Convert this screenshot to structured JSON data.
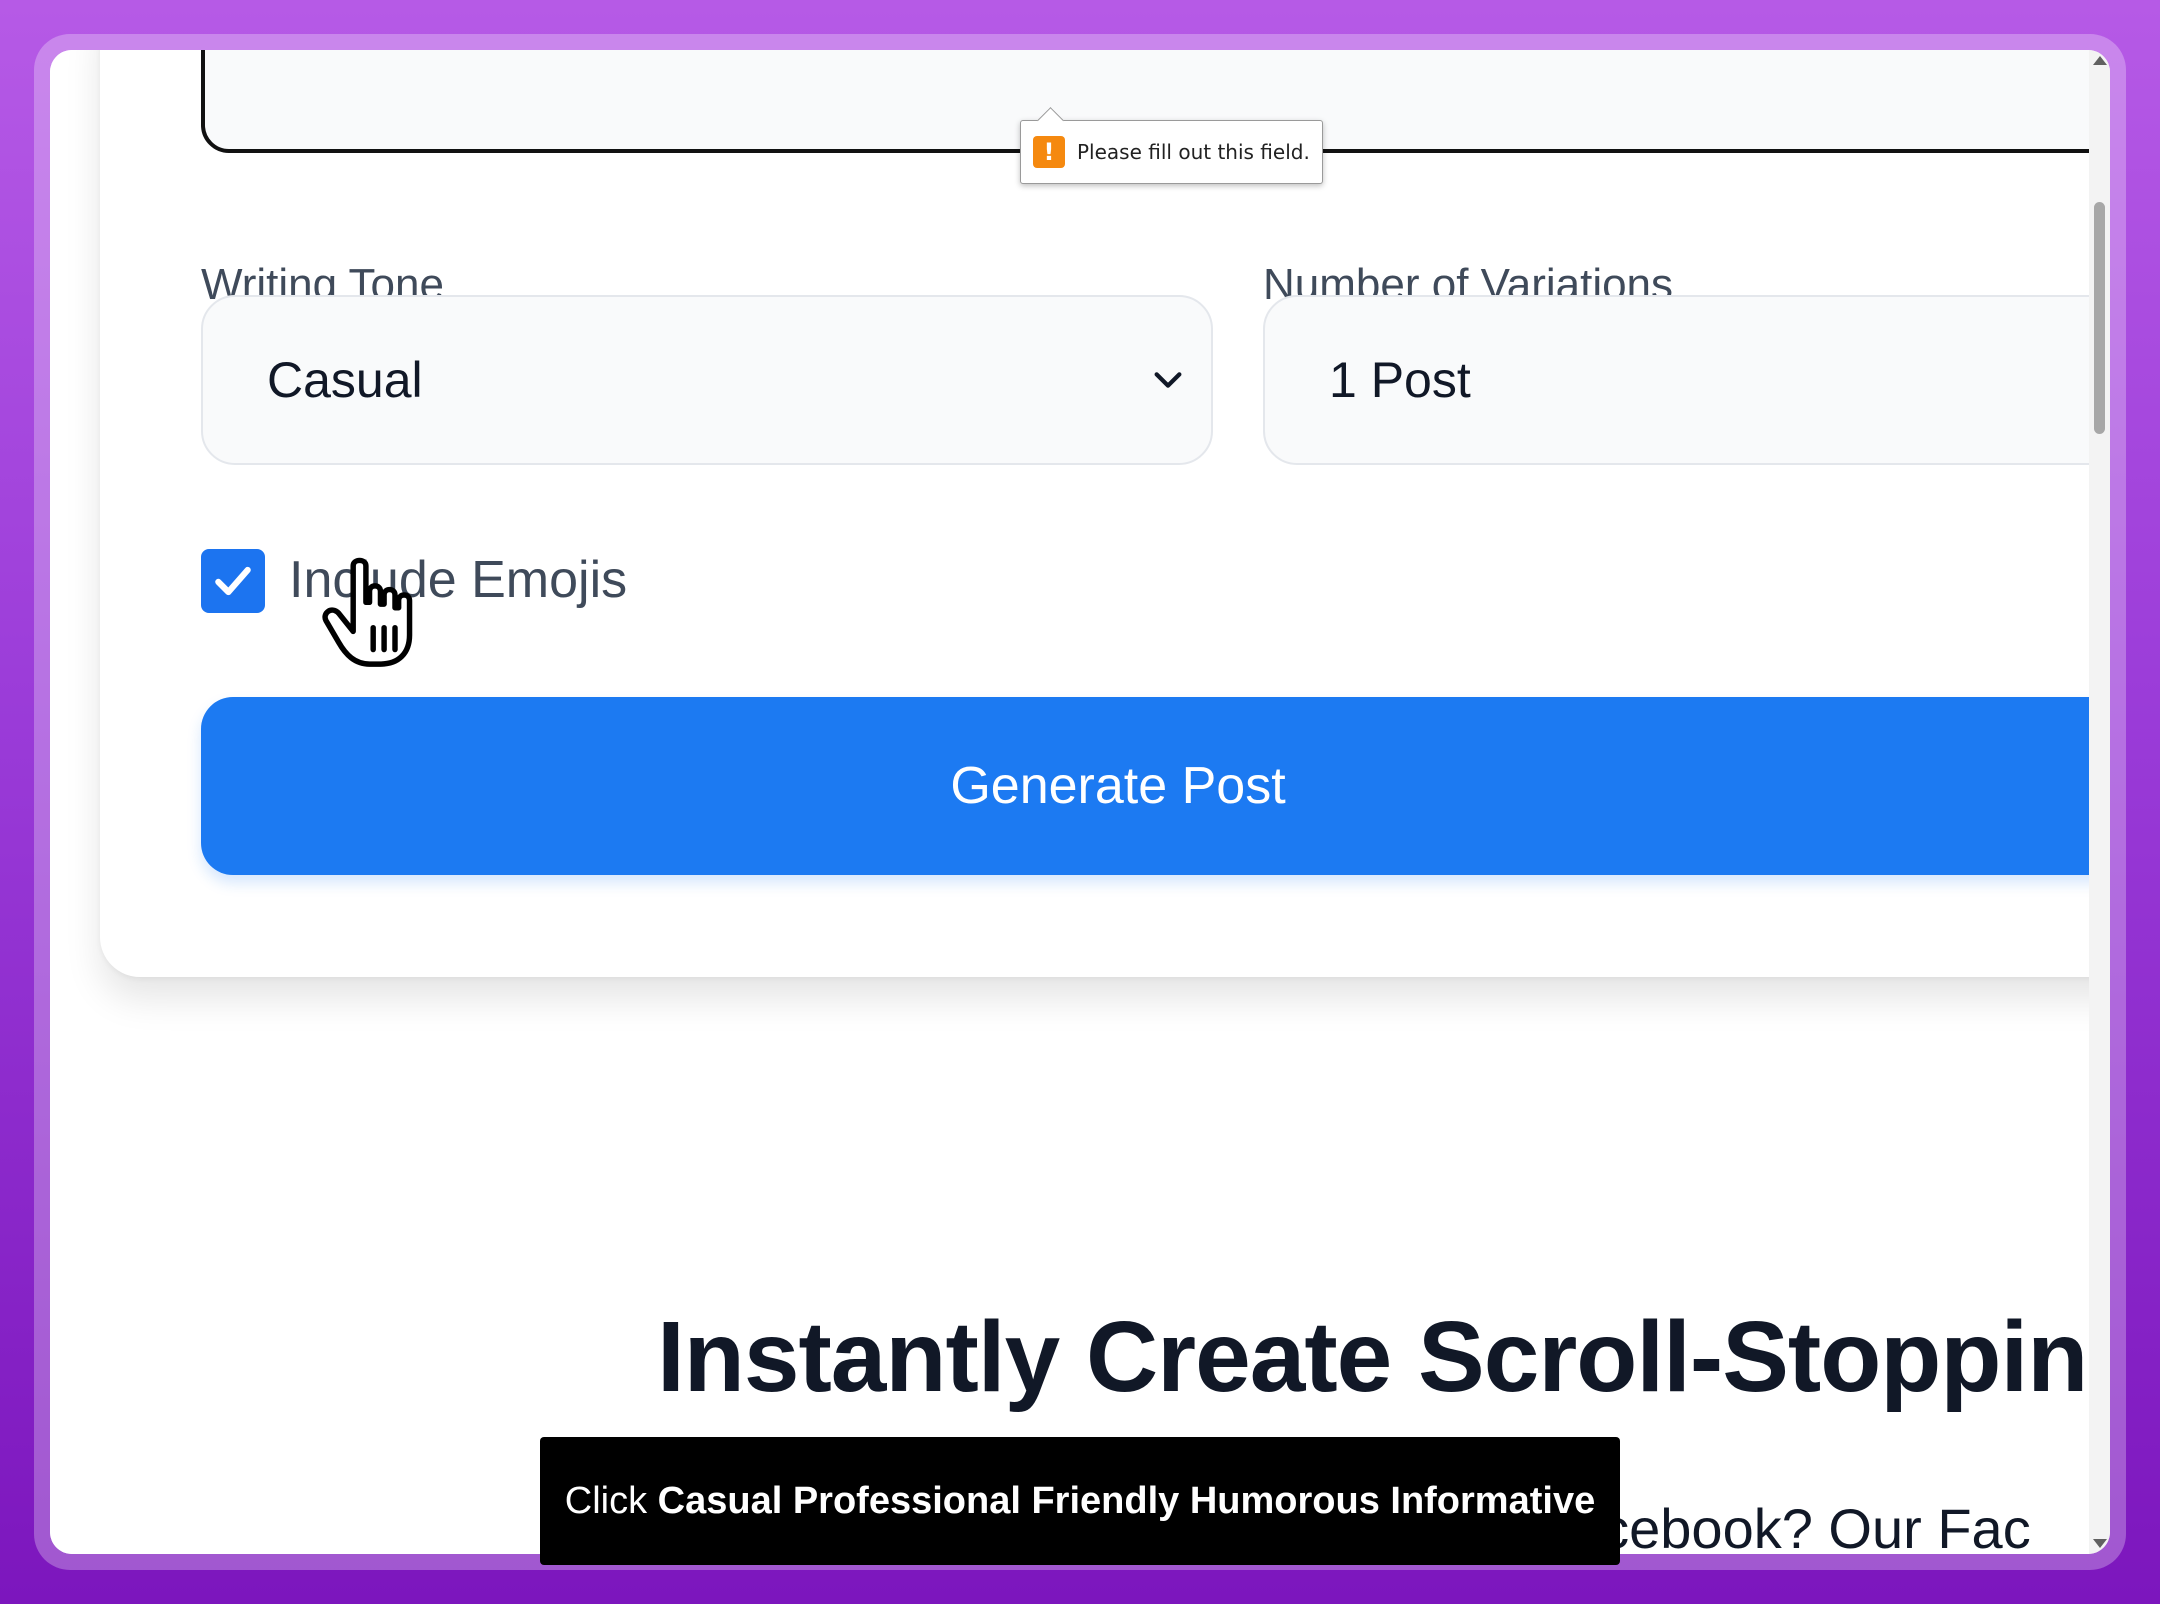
{
  "tooltip": {
    "message": "Please fill out this field.",
    "icon": "warning-icon"
  },
  "form": {
    "tone_label": "Writing Tone",
    "tone_value": "Casual",
    "variations_label": "Number of Variations",
    "variations_value": "1 Post",
    "emoji_label": "Include Emojis",
    "emoji_checked": true,
    "generate_label": "Generate Post"
  },
  "section": {
    "headline": "Instantly Create Scroll-Stoppin",
    "subline": "acebook? Our Fac"
  },
  "caption": {
    "prefix": "Click ",
    "target": "Casual Professional Friendly Humorous Informative"
  },
  "colors": {
    "accent": "#1c7af2",
    "checkbox": "#1c74f0",
    "warning": "#f5890f"
  }
}
